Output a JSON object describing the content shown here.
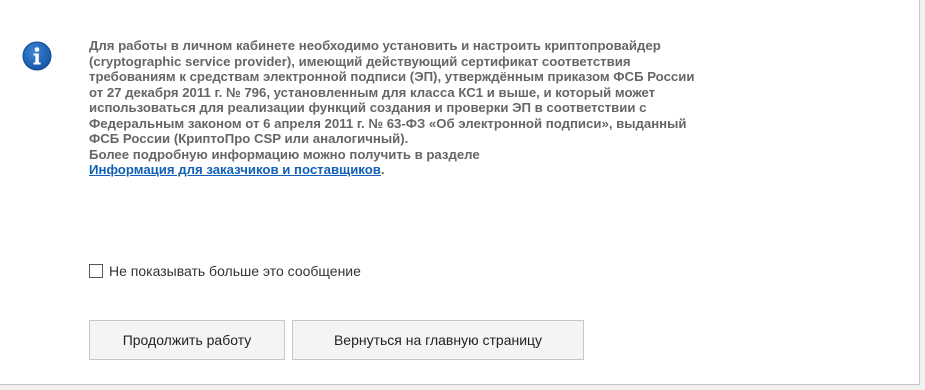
{
  "dialog": {
    "icon": "info-circle-icon",
    "accent_color": "#1a63b3",
    "message_lines": [
      "Для работы в личном кабинете необходимо установить и настроить криптопровайдер",
      "(cryptographic service provider), имеющий действующий сертификат соответствия",
      "требованиям к средствам электронной подписи (ЭП), утверждённым приказом ФСБ России",
      "от 27 декабря 2011 г. № 796, установленным для класса КС1 и выше, и который может",
      "использоваться для реализации функций создания и проверки ЭП в соответствии с",
      "Федеральным законом от 6 апреля 2011 г. № 63-ФЗ «Об электронной подписи», выданный",
      "ФСБ России (КриптоПро CSP или аналогичный).",
      "Более подробную информацию можно получить в разделе"
    ],
    "link_text": "Информация для заказчиков и поставщиков",
    "link_suffix": ".",
    "link_color": "#1060b6",
    "checkbox": {
      "label": "Не показывать больше это сообщение",
      "checked": false
    },
    "buttons": {
      "continue_label": "Продолжить работу",
      "home_label": "Вернуться на главную страницу"
    }
  }
}
